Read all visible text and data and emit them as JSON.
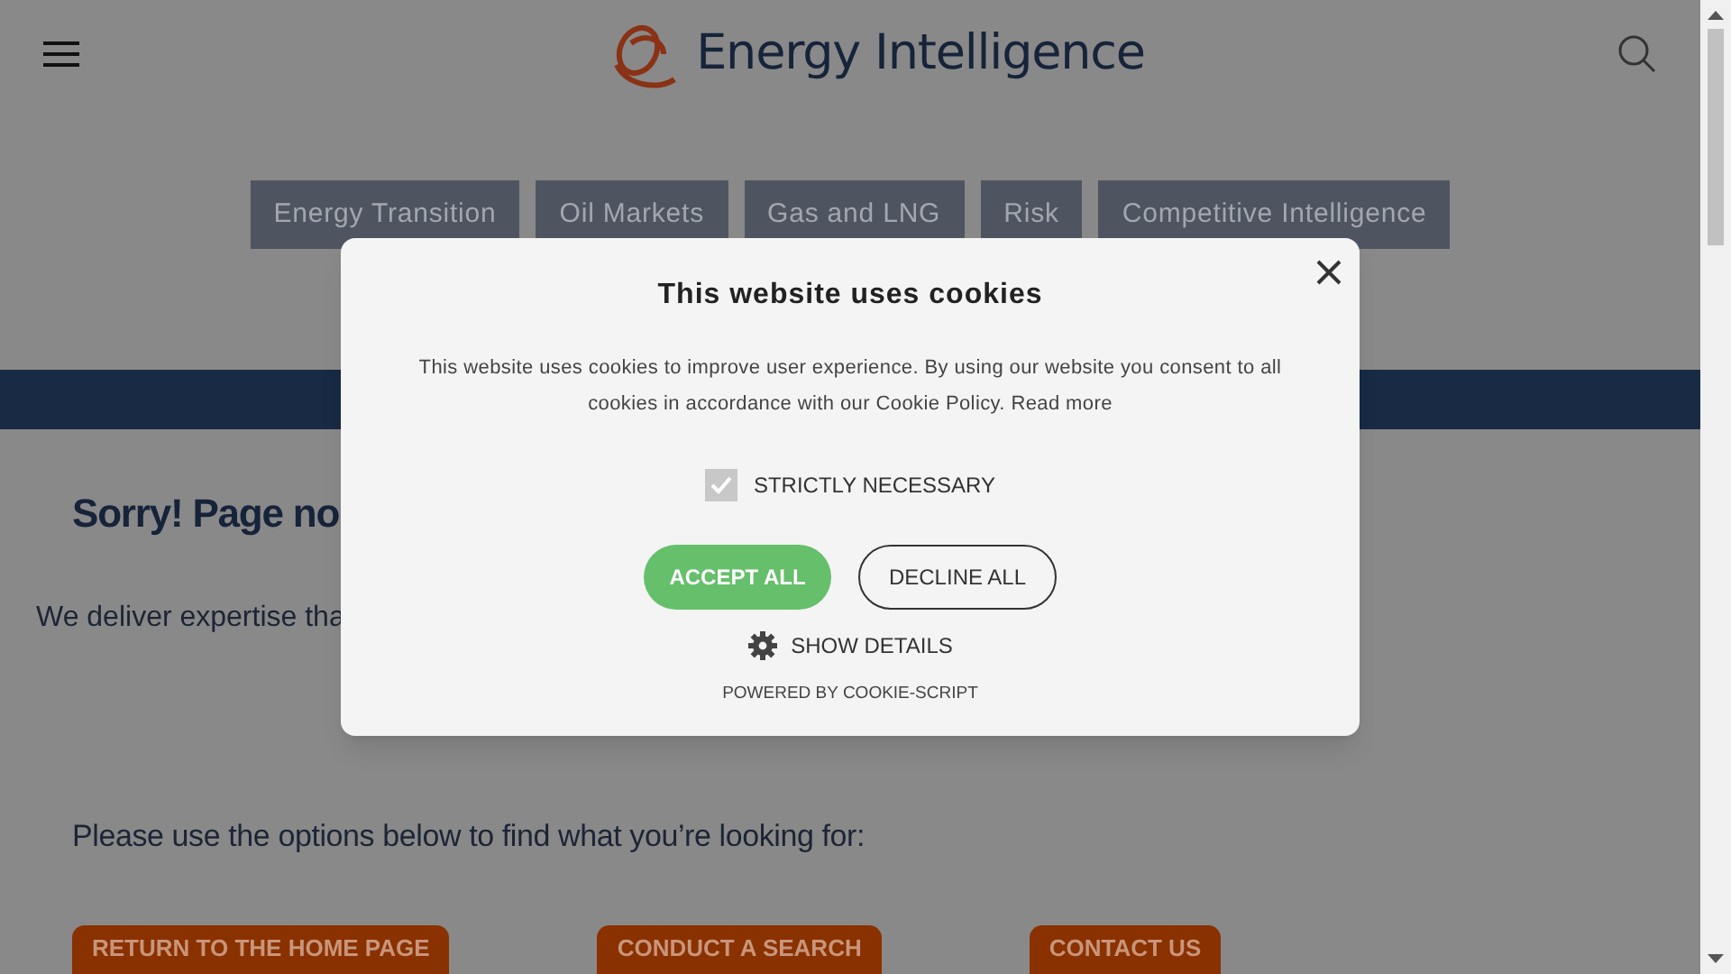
{
  "header": {
    "logo_text": "Energy Intelligence"
  },
  "nav_tabs": [
    {
      "label": "Energy Transition"
    },
    {
      "label": "Oil Markets"
    },
    {
      "label": "Gas and LNG"
    },
    {
      "label": "Risk"
    },
    {
      "label": "Competitive Intelligence"
    }
  ],
  "page": {
    "heading": "Sorry! Page no",
    "intro": "We deliver expertise tha",
    "prompt": "Please use the options below to find what you’re looking for:",
    "buttons": [
      {
        "label": "RETURN TO THE HOME PAGE"
      },
      {
        "label": "CONDUCT A SEARCH"
      },
      {
        "label": "CONTACT US"
      }
    ]
  },
  "cookie_dialog": {
    "title": "This website uses cookies",
    "body": "This website uses cookies to improve user experience. By using our website you consent to all cookies in accordance with our Cookie Policy.",
    "read_more": "Read more",
    "checkbox": {
      "label": "STRICTLY NECESSARY",
      "checked": true
    },
    "accept": "ACCEPT ALL",
    "decline": "DECLINE ALL",
    "show_details": "SHOW DETAILS",
    "powered_by": "POWERED BY COOKIE-SCRIPT"
  }
}
